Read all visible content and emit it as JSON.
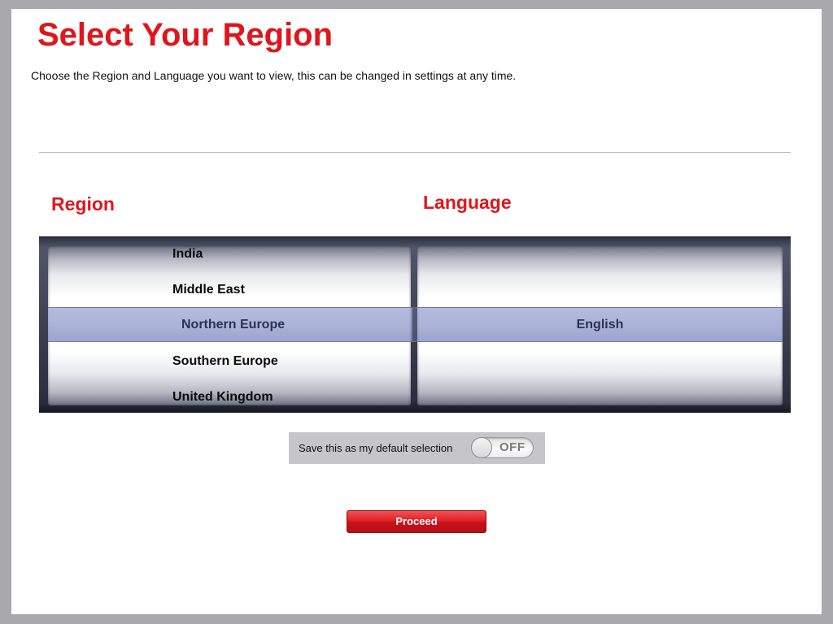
{
  "header": {
    "title": "Select Your Region",
    "subtitle": "Choose the Region and Language you want to view, this can be changed in settings at any time."
  },
  "columns": {
    "region_label": "Region",
    "language_label": "Language"
  },
  "region_picker": {
    "items": [
      "India",
      "Middle East",
      "Northern Europe",
      "Southern Europe",
      "United Kingdom"
    ],
    "selected": "Northern Europe"
  },
  "language_picker": {
    "items": [
      "English"
    ],
    "selected": "English"
  },
  "default_selection": {
    "label": "Save this as my default selection",
    "toggle_state": "OFF"
  },
  "proceed_label": "Proceed",
  "colors": {
    "accent_red": "#e0161b",
    "background": "#a9a9ab",
    "selection_bar": "#9aa2d2"
  }
}
